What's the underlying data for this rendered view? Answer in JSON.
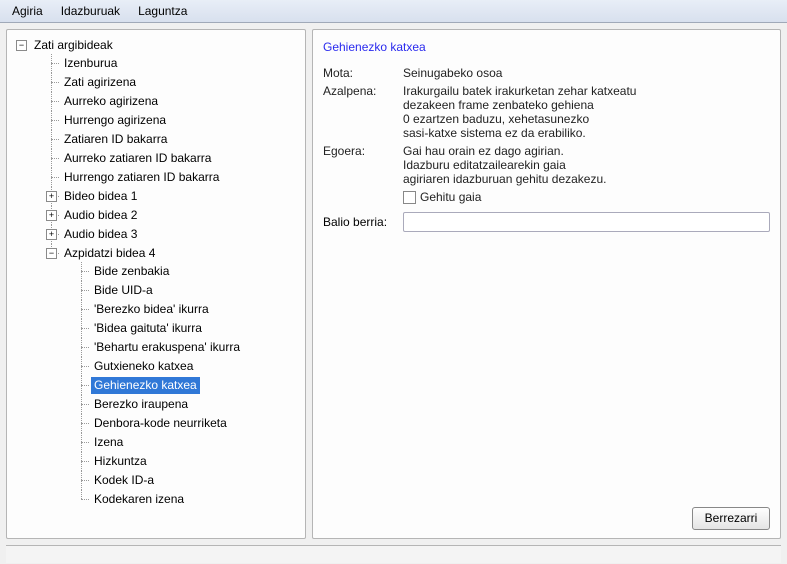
{
  "menu": {
    "file": "Agiria",
    "headers": "Idazburuak",
    "help": "Laguntza"
  },
  "tree": {
    "root": {
      "label": "Zati argibideak"
    },
    "r1": [
      "Izenburua",
      "Zati agirizena",
      "Aurreko agirizena",
      "Hurrengo agirizena",
      "Zatiaren ID bakarra",
      "Aurreko zatiaren ID bakarra",
      "Hurrengo zatiaren ID bakarra"
    ],
    "c1": "Bideo bidea 1",
    "c2": "Audio bidea 2",
    "c3": "Audio bidea 3",
    "c4": {
      "label": "Azpidatzi bidea 4"
    },
    "c4items": [
      "Bide zenbakia",
      "Bide UID-a",
      "'Berezko bidea' ikurra",
      "'Bidea gaituta' ikurra",
      "'Behartu erakuspena' ikurra",
      "Gutxieneko katxea",
      "Gehienezko katxea",
      "Berezko iraupena",
      "Denbora-kode neurriketa",
      "Izena",
      "Hizkuntza",
      "Kodek ID-a",
      "Kodekaren izena"
    ],
    "selectedIndex": 6
  },
  "detail": {
    "title": "Gehienezko katxea",
    "type_label": "Mota:",
    "type_value": "Seinugabeko osoa",
    "expl_label": "Azalpena:",
    "expl_value": "Irakurgailu batek irakurketan zehar katxeatu\ndezakeen frame zenbateko gehiena\n0 ezartzen baduzu, xehetasunezko\nsasi-katxe sistema ez da erabiliko.",
    "state_label": "Egoera:",
    "state_value": "Gai hau orain ez dago agirian.\nIdazburu editatzailearekin gaia\nagiriaren idazburuan gehitu dezakezu.",
    "checkbox_label": "Gehitu gaia",
    "newval_label": "Balio berria:",
    "reset_button": "Berrezarri"
  }
}
